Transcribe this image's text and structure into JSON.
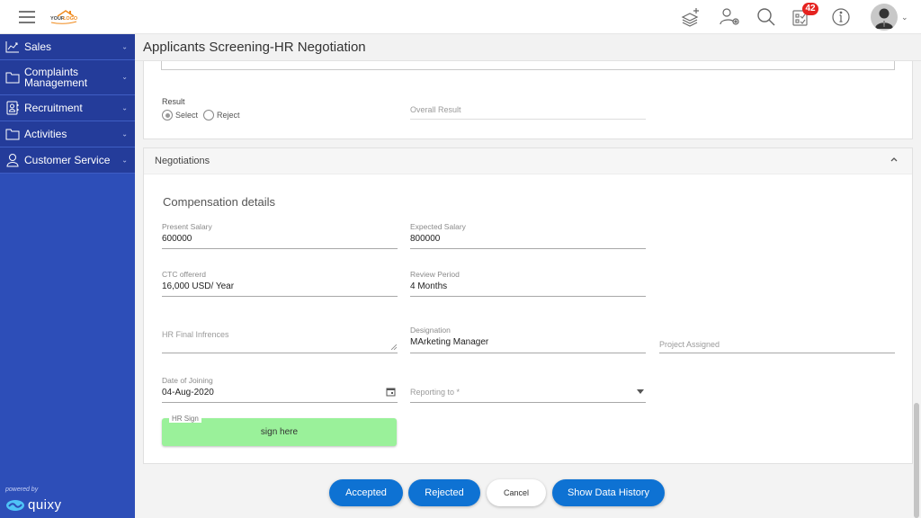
{
  "header": {
    "logo_text": "YOUR LOGO",
    "notification_count": "42",
    "icons": [
      "add-layers-icon",
      "user-settings-icon",
      "search-icon",
      "tasks-icon",
      "info-icon",
      "user-avatar-icon"
    ]
  },
  "sidebar": {
    "items": [
      {
        "label": "Sales",
        "icon": "chart-icon"
      },
      {
        "label": "Complaints Management",
        "icon": "folder-icon"
      },
      {
        "label": "Recruitment",
        "icon": "contact-book-icon"
      },
      {
        "label": "Activities",
        "icon": "folder-icon"
      },
      {
        "label": "Customer Service",
        "icon": "person-icon"
      }
    ],
    "powered_by": "powered by",
    "brand": "quixy"
  },
  "page": {
    "title": "Applicants Screening-HR Negotiation"
  },
  "result_section": {
    "label": "Result",
    "options": [
      "Select",
      "Reject"
    ],
    "selected": "Select",
    "overall_result_placeholder": "Overall Result"
  },
  "negotiations": {
    "title": "Negotiations",
    "section_title": "Compensation details",
    "present_salary": {
      "label": "Present Salary",
      "value": "600000"
    },
    "expected_salary": {
      "label": "Expected Salary",
      "value": "800000"
    },
    "ctc_offered": {
      "label": "CTC offererd",
      "value": "16,000 USD/ Year"
    },
    "review_period": {
      "label": "Review Period",
      "value": "4 Months"
    },
    "hr_final_inferences": {
      "placeholder": "HR Final Infrences"
    },
    "designation": {
      "label": "Designation",
      "value": "MArketing Manager"
    },
    "project_assigned": {
      "placeholder": "Project Assigned"
    },
    "date_of_joining": {
      "label": "Date of Joining",
      "value": "04-Aug-2020"
    },
    "reporting_to": {
      "placeholder": "Reporting to *"
    },
    "hr_sign": {
      "label": "HR Sign",
      "text": "sign here"
    }
  },
  "actions": {
    "accepted": "Accepted",
    "rejected": "Rejected",
    "cancel": "Cancel",
    "history": "Show Data History"
  },
  "colors": {
    "sidebar": "#2d4eb8",
    "primary_button": "#0e72d3",
    "sign_pad": "#9af19a",
    "badge": "#e52320"
  }
}
